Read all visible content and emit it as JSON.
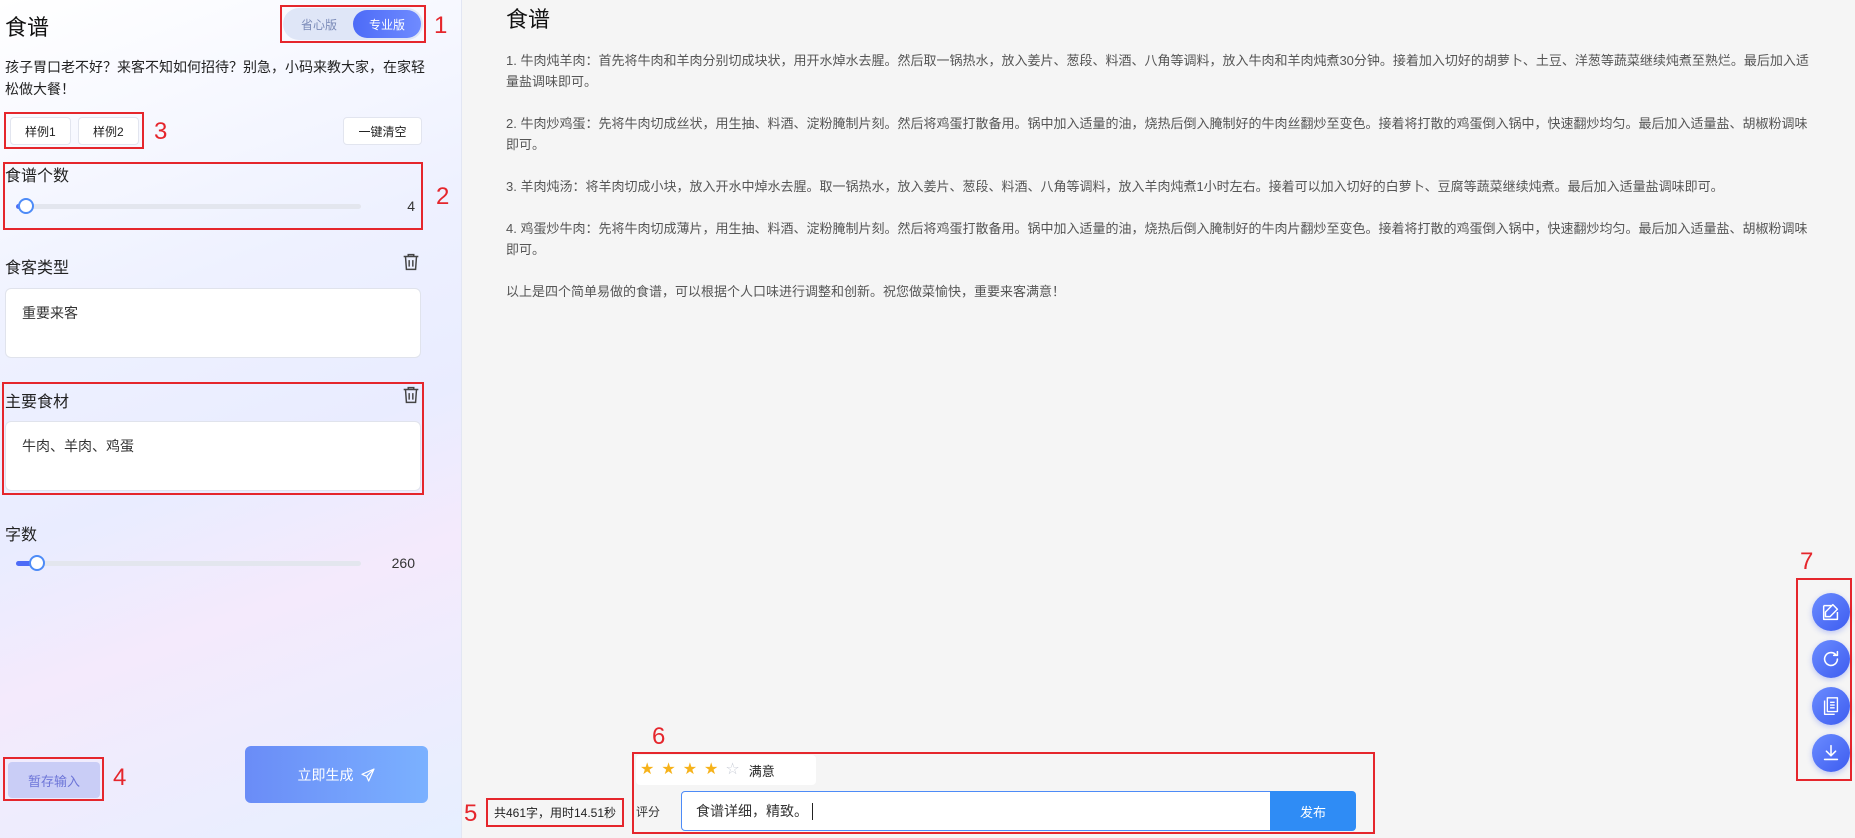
{
  "left": {
    "title": "食谱",
    "mode_toggle": {
      "simple": "省心版",
      "pro": "专业版",
      "active": "pro"
    },
    "description": "孩子胃口老不好？来客不知如何招待？别急，小码来教大家，在家轻松做大餐！",
    "examples": [
      "样例1",
      "样例2"
    ],
    "clear_label": "一键清空",
    "recipe_count": {
      "label": "食谱个数",
      "value": "4",
      "fraction": 0.03
    },
    "guest_type": {
      "label": "食客类型",
      "value": "重要来客"
    },
    "ingredients": {
      "label": "主要食材",
      "value": "牛肉、羊肉、鸡蛋"
    },
    "word_count": {
      "label": "字数",
      "value": "260",
      "fraction": 0.06
    },
    "save_label": "暂存输入",
    "generate_label": "立即生成"
  },
  "right": {
    "title": "食谱",
    "paragraphs": [
      "1. 牛肉炖羊肉：首先将牛肉和羊肉分别切成块状，用开水焯水去腥。然后取一锅热水，放入姜片、葱段、料酒、八角等调料，放入牛肉和羊肉炖煮30分钟。接着加入切好的胡萝卜、土豆、洋葱等蔬菜继续炖煮至熟烂。最后加入适量盐调味即可。",
      "2. 牛肉炒鸡蛋：先将牛肉切成丝状，用生抽、料酒、淀粉腌制片刻。然后将鸡蛋打散备用。锅中加入适量的油，烧热后倒入腌制好的牛肉丝翻炒至变色。接着将打散的鸡蛋倒入锅中，快速翻炒均匀。最后加入适量盐、胡椒粉调味即可。",
      "3. 羊肉炖汤：将羊肉切成小块，放入开水中焯水去腥。取一锅热水，放入姜片、葱段、料酒、八角等调料，放入羊肉炖煮1小时左右。接着可以加入切好的白萝卜、豆腐等蔬菜继续炖煮。最后加入适量盐调味即可。",
      "4. 鸡蛋炒牛肉：先将牛肉切成薄片，用生抽、料酒、淀粉腌制片刻。然后将鸡蛋打散备用。锅中加入适量的油，烧热后倒入腌制好的牛肉片翻炒至变色。接着将打散的鸡蛋倒入锅中，快速翻炒均匀。最后加入适量盐、胡椒粉调味即可。",
      "以上是四个简单易做的食谱，可以根据个人口味进行调整和创新。祝您做菜愉快，重要来客满意！"
    ],
    "stats": "共461字，用时14.51秒",
    "rating": {
      "stars": 4,
      "max": 5,
      "text": "满意",
      "label": "评分"
    },
    "feedback_value": "食谱详细，精致。",
    "publish_label": "发布"
  },
  "annotations": [
    "1",
    "2",
    "3",
    "4",
    "5",
    "6",
    "7"
  ],
  "fab_icons": [
    "edit-icon",
    "refresh-icon",
    "copy-icon",
    "download-icon"
  ],
  "colors": {
    "accent": "#4d6bf7",
    "annotation": "#e5262c",
    "publish": "#2f8cf5",
    "star": "#f6b21a"
  }
}
